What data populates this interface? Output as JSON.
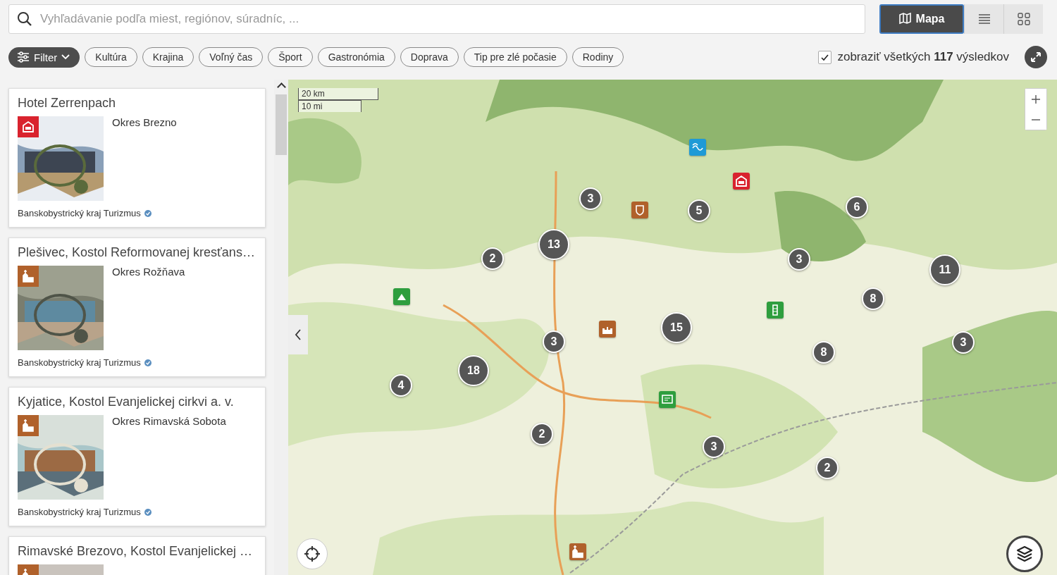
{
  "search": {
    "placeholder": "Vyhľadávanie podľa miest, regiónov, súradníc, ..."
  },
  "views": [
    {
      "kind": "map",
      "label": "Mapa",
      "selected": true
    },
    {
      "kind": "list",
      "selected": false
    },
    {
      "kind": "grid",
      "selected": false
    }
  ],
  "filter_button": {
    "label": "Filter"
  },
  "categories": [
    {
      "label": "Kultúra"
    },
    {
      "label": "Krajina"
    },
    {
      "label": "Voľný čas"
    },
    {
      "label": "Šport"
    },
    {
      "label": "Gastronómia"
    },
    {
      "label": "Doprava"
    },
    {
      "label": "Tip pre zlé počasie"
    },
    {
      "label": "Rodiny"
    }
  ],
  "show_all": {
    "checked": true,
    "label": "zobraziť všetkých **117** výsledkov"
  },
  "results": [
    {
      "title": "Hotel Zerrenpach",
      "badge": {
        "kind": "hotel",
        "color": "#d9232e"
      },
      "district": "Okres Brezno",
      "source": "Banskobystrický kraj Turizmus"
    },
    {
      "title": "Plešivec, Kostol Reformovanej kresťans…",
      "badge": {
        "kind": "church",
        "color": "#b0612b"
      },
      "district": "Okres Rožňava",
      "source": "Banskobystrický kraj Turizmus"
    },
    {
      "title": "Kyjatice, Kostol Evanjelickej cirkvi a. v.",
      "badge": {
        "kind": "church",
        "color": "#b0612b"
      },
      "district": "Okres Rimavská Sobota",
      "source": "Banskobystrický kraj Turizmus"
    },
    {
      "title": "Rimavské Brezovo, Kostol Evanjelickej …",
      "badge": {
        "kind": "church",
        "color": "#b0612b"
      }
    }
  ],
  "map": {
    "scale": [
      "20 km",
      "10 mi"
    ],
    "markers": [
      {
        "kind": "cluster",
        "count": "3"
      },
      {
        "kind": "cluster",
        "count": "5"
      },
      {
        "kind": "cluster",
        "count": "6"
      },
      {
        "kind": "cluster",
        "count": "13"
      },
      {
        "kind": "cluster",
        "count": "2"
      },
      {
        "kind": "cluster",
        "count": "3"
      },
      {
        "kind": "cluster",
        "count": "11"
      },
      {
        "kind": "cluster",
        "count": "8"
      },
      {
        "kind": "cluster",
        "count": "15"
      },
      {
        "kind": "cluster",
        "count": "3"
      },
      {
        "kind": "cluster",
        "count": "8"
      },
      {
        "kind": "cluster",
        "count": "3"
      },
      {
        "kind": "cluster",
        "count": "18"
      },
      {
        "kind": "cluster",
        "count": "4"
      },
      {
        "kind": "cluster",
        "count": "2"
      },
      {
        "kind": "cluster",
        "count": "3"
      },
      {
        "kind": "cluster",
        "count": "2"
      },
      {
        "kind": "wave",
        "color": "#1e9ad6"
      },
      {
        "kind": "hotel",
        "color": "#d9232e"
      },
      {
        "kind": "shield",
        "color": "#b0612b"
      },
      {
        "kind": "mountain",
        "color": "#2e9e3e"
      },
      {
        "kind": "tower",
        "color": "#2e9e3e"
      },
      {
        "kind": "castle",
        "color": "#b0612b"
      },
      {
        "kind": "board",
        "color": "#2e9e3e"
      },
      {
        "kind": "church",
        "color": "#b0612b"
      }
    ]
  }
}
